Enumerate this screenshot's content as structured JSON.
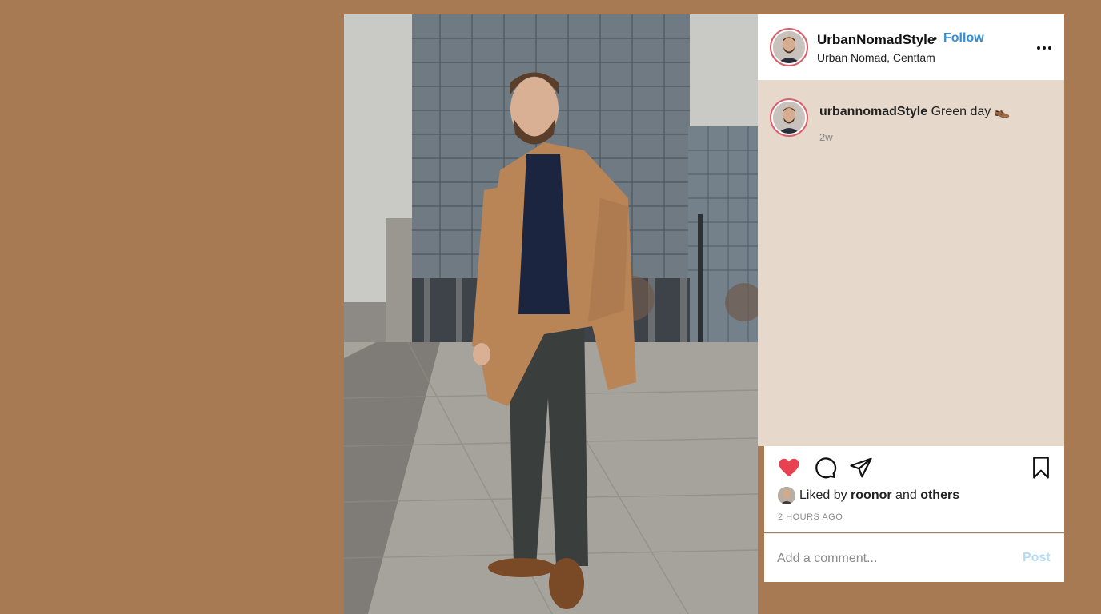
{
  "post": {
    "photo_alt": "Man in camel coat standing on cobblestone street in front of glass office building"
  },
  "header": {
    "username": "UrbanNomadStyle",
    "separator": "•",
    "follow_label": "Follow",
    "location": "Urban Nomad, Centtam",
    "more_icon": "more-horizontal-icon"
  },
  "caption": {
    "username": "urbannomadStyle",
    "text": "Green day 👞",
    "time": "2w"
  },
  "actions": {
    "like_icon": "heart-icon",
    "comment_icon": "comment-icon",
    "share_icon": "share-icon",
    "save_icon": "bookmark-icon",
    "liked_prefix": "Liked by",
    "liked_user": "roonor",
    "liked_and": "and",
    "liked_others": "others",
    "time_ago": "2 HOURS AGO"
  },
  "comment": {
    "placeholder": "Add a comment...",
    "post_label": "Post"
  },
  "colors": {
    "page_background": "#a87a54",
    "follow_blue": "#2f8fd8",
    "heart_red": "#e8414f",
    "post_disabled": "#b5dcf5",
    "caption_panel": "#e6d8cb"
  }
}
